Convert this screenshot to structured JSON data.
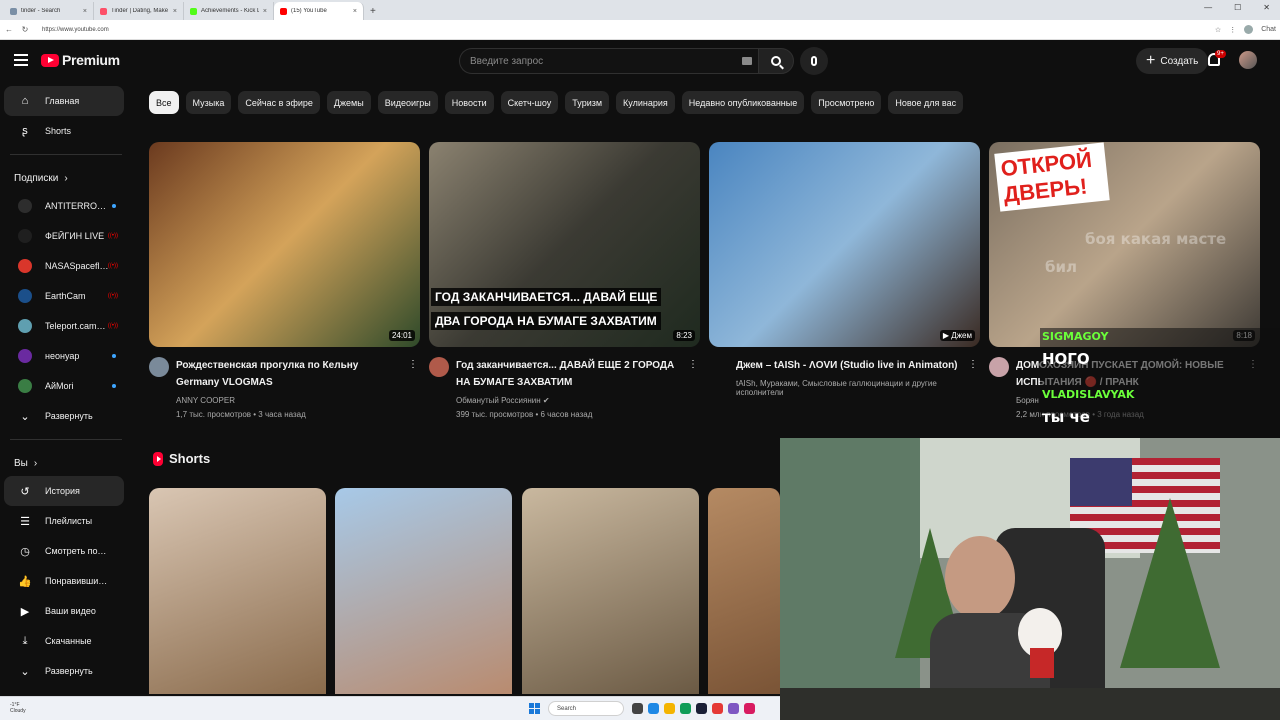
{
  "browser": {
    "tabs": [
      {
        "title": "tinder - Search",
        "color": "#7a8fa6"
      },
      {
        "title": "Tinder | Dating, Make Friends & M",
        "color": "#fd5068"
      },
      {
        "title": "Achievements - Kick Dashboard",
        "color": "#53fc18"
      },
      {
        "title": "(15) YouTube",
        "color": "#ff0000"
      }
    ],
    "new_tab": "+",
    "url": "https://www.youtube.com",
    "win_min": "—",
    "win_max": "☐",
    "win_close": "✕",
    "chat_label": "Chat"
  },
  "header": {
    "logo_text": "Premium",
    "search_placeholder": "Введите запрос",
    "create_label": "Создать",
    "notifications_badge": "9+"
  },
  "sidebar": {
    "main": [
      {
        "label": "Главная",
        "icon": "home-icon",
        "glyph": "⌂"
      },
      {
        "label": "Shorts",
        "icon": "shorts-icon",
        "glyph": "ʂ"
      }
    ],
    "subscriptions_title": "Подписки",
    "subscriptions": [
      {
        "label": "ANTITERROR Ch...",
        "color": "#2d2d2d",
        "status": "new"
      },
      {
        "label": "ФЕЙГИН LIVE",
        "color": "#1f1f1f",
        "status": "live"
      },
      {
        "label": "NASASpaceflight",
        "color": "#d9362b",
        "status": "live"
      },
      {
        "label": "EarthCam",
        "color": "#1b4f8a",
        "status": "live"
      },
      {
        "label": "Teleport.camera",
        "color": "#5f9fb0",
        "status": "live"
      },
      {
        "label": "неонуар",
        "color": "#6a2aa0",
        "status": "new"
      },
      {
        "label": "АйМori",
        "color": "#3a7d44",
        "status": "new"
      }
    ],
    "expand_label": "Развернуть",
    "you_title": "Вы",
    "you_items": [
      {
        "label": "История",
        "icon": "history-icon",
        "glyph": "↺"
      },
      {
        "label": "Плейлисты",
        "icon": "playlists-icon",
        "glyph": "☰"
      },
      {
        "label": "Смотреть позже",
        "icon": "watch-later-icon",
        "glyph": "◷"
      },
      {
        "label": "Понравившиеся",
        "icon": "liked-icon",
        "glyph": "👍"
      },
      {
        "label": "Ваши видео",
        "icon": "your-videos-icon",
        "glyph": "▶"
      },
      {
        "label": "Скачанные",
        "icon": "downloads-icon",
        "glyph": "⤓"
      },
      {
        "label": "Развернуть",
        "icon": "chevron-down-icon",
        "glyph": "⌄"
      }
    ]
  },
  "chips": [
    "Все",
    "Музыка",
    "Сейчас в эфире",
    "Джемы",
    "Видеоигры",
    "Новости",
    "Скетч-шоу",
    "Туризм",
    "Кулинария",
    "Недавно опубликованные",
    "Просмотрено",
    "Новое для вас"
  ],
  "videos": [
    {
      "title": "Рождественская прогулка по Кельну Germany VLOGMAS",
      "channel": "ANNY COOPER",
      "stats": "1,7 тыс. просмотров • 3 часа назад",
      "duration": "24:01",
      "thumb_colors": [
        "#6b3a1f",
        "#d4a35a",
        "#2f4a2a"
      ],
      "avatar_color": "#7a8a9a"
    },
    {
      "title": "Год заканчивается... ДАВАЙ ЕЩЕ 2 ГОРОДА НА БУМАГЕ ЗАХВАТИМ",
      "channel": "Обманутый Россиянин ✔",
      "stats": "399 тыс. просмотров • 6 часов назад",
      "duration": "8:23",
      "overlay_line1": "ГОД ЗАКАНЧИВАЕТСЯ... ДАВАЙ ЕЩЕ",
      "overlay_line2": "ДВА ГОРОДА НА БУМАГЕ ЗАХВАТИМ",
      "thumb_colors": [
        "#8b8270",
        "#3b3a33",
        "#1f2a1f"
      ],
      "avatar_color": "#b05a4a"
    },
    {
      "title": "Джем – tAISh - ΛOVИ (Studio live in Animaton)",
      "channel": "tAISh, Мураками, Смысловые галлюцинации и другие исполнители",
      "stats": "",
      "duration": "▶ Джем",
      "thumb_colors": [
        "#4a85c0",
        "#8fb7d9",
        "#3a2a22"
      ],
      "avatar_color": ""
    },
    {
      "title": "ДОМОХОЗЯИН ПУСКАЕТ ДОМОЙ: НОВЫЕ ИСПЫТАНИЯ 🔴 / ПРАНК",
      "channel": "Борян",
      "stats": "2,2 млн просмотров • 3 года назад",
      "duration": "8:18",
      "overlay_big": "ОТКРОЙ ДВЕРЬ!",
      "thumb_colors": [
        "#7a6e60",
        "#b9a48a",
        "#3e3a35"
      ],
      "avatar_color": "#c8a2a8"
    }
  ],
  "shorts": {
    "title": "Shorts",
    "items": [
      {
        "colors": [
          "#d9c6b3",
          "#8a6b4c"
        ]
      },
      {
        "colors": [
          "#a7c9e8",
          "#b98b6f"
        ]
      },
      {
        "colors": [
          "#c9b89f",
          "#6b5a44"
        ]
      },
      {
        "colors": [
          "#b58a63",
          "#7a5436"
        ]
      }
    ]
  },
  "chat_overlay": {
    "lines": [
      {
        "type": "name",
        "text": "SIGMAGOY"
      },
      {
        "type": "msg",
        "text": "НОГО"
      },
      {
        "type": "name",
        "text": "VLADISLAVYAK"
      },
      {
        "type": "msg",
        "text": "ты че"
      }
    ],
    "ghost_text": "боя какая масте",
    "ghost_text2": "бил"
  },
  "taskbar": {
    "weather_temp": "-1°F",
    "weather_desc": "Cloudy",
    "search_label": "Search"
  }
}
